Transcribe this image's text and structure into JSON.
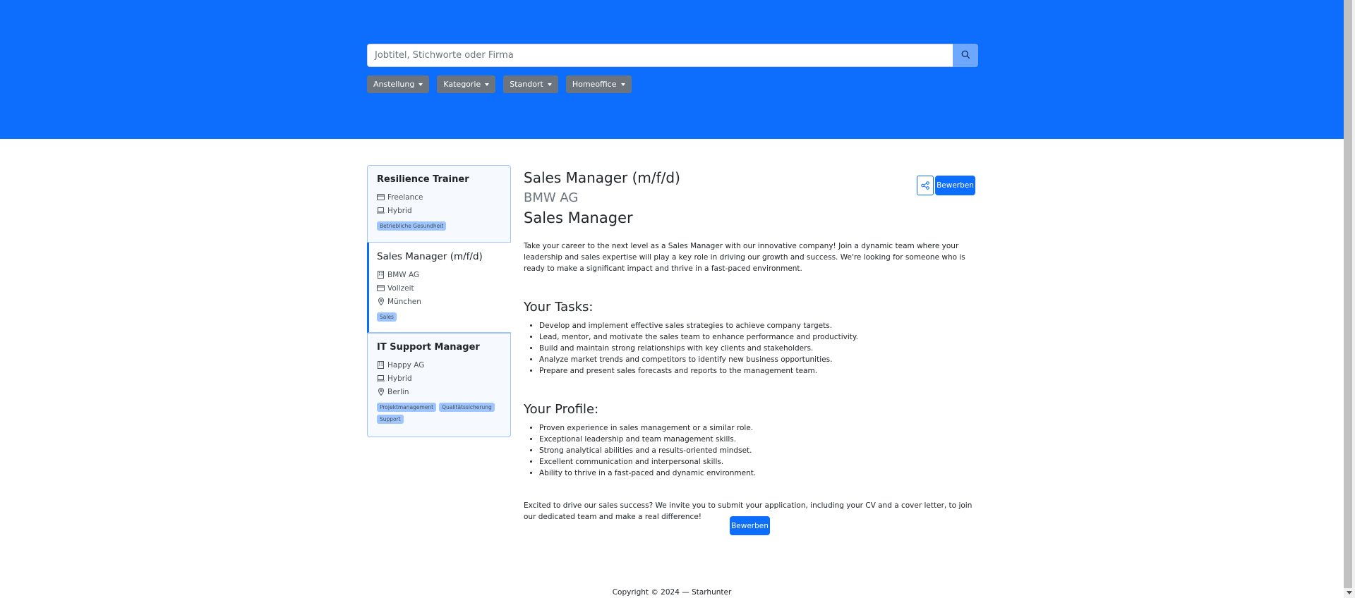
{
  "search": {
    "placeholder": "Jobtitel, Stichworte oder Firma"
  },
  "filters": [
    "Anstellung",
    "Kategorie",
    "Standort",
    "Homeoffice"
  ],
  "jobs": [
    {
      "title": "Resilience Trainer",
      "type": "Freelance",
      "mode": "Hybrid",
      "tags": [
        "Betriebliche Gesundheit"
      ]
    },
    {
      "title": "Sales Manager (m/f/d)",
      "company": "BMW AG",
      "type": "Vollzeit",
      "location": "München",
      "tags": [
        "Sales"
      ]
    },
    {
      "title": "IT Support Manager",
      "company": "Happy AG",
      "mode": "Hybrid",
      "location": "Berlin",
      "tags": [
        "Projektmanagement",
        "Qualitätssicherung",
        "Support"
      ]
    }
  ],
  "detail": {
    "title": "Sales Manager (m/f/d)",
    "company": "BMW AG",
    "subtitle": "Sales Manager",
    "intro": "Take your career to the next level as a Sales Manager with our innovative company! Join a dynamic team where your leadership and sales expertise will play a key role in driving our growth and success. We're looking for someone who is ready to make a significant impact and thrive in a fast-paced environment.",
    "tasks_heading": "Your Tasks:",
    "tasks": [
      "Develop and implement effective sales strategies to achieve company targets.",
      "Lead, mentor, and motivate the sales team to enhance performance and productivity.",
      "Build and maintain strong relationships with key clients and stakeholders.",
      "Analyze market trends and competitors to identify new business opportunities.",
      "Prepare and present sales forecasts and reports to the management team."
    ],
    "profile_heading": "Your Profile:",
    "profile": [
      "Proven experience in sales management or a similar role.",
      "Exceptional leadership and team management skills.",
      "Strong analytical abilities and a results-oriented mindset.",
      "Excellent communication and interpersonal skills.",
      "Ability to thrive in a fast-paced and dynamic environment."
    ],
    "outro": "Excited to drive our sales success? We invite you to submit your application, including your CV and a cover letter, to join our dedicated team and make a real difference!",
    "apply_label": "Bewerben"
  },
  "footer": "Copyright © 2024 — Starhunter",
  "colors": {
    "primary": "#0d6efd",
    "secondary": "#6c757d",
    "tag": "#9ec5fe"
  }
}
